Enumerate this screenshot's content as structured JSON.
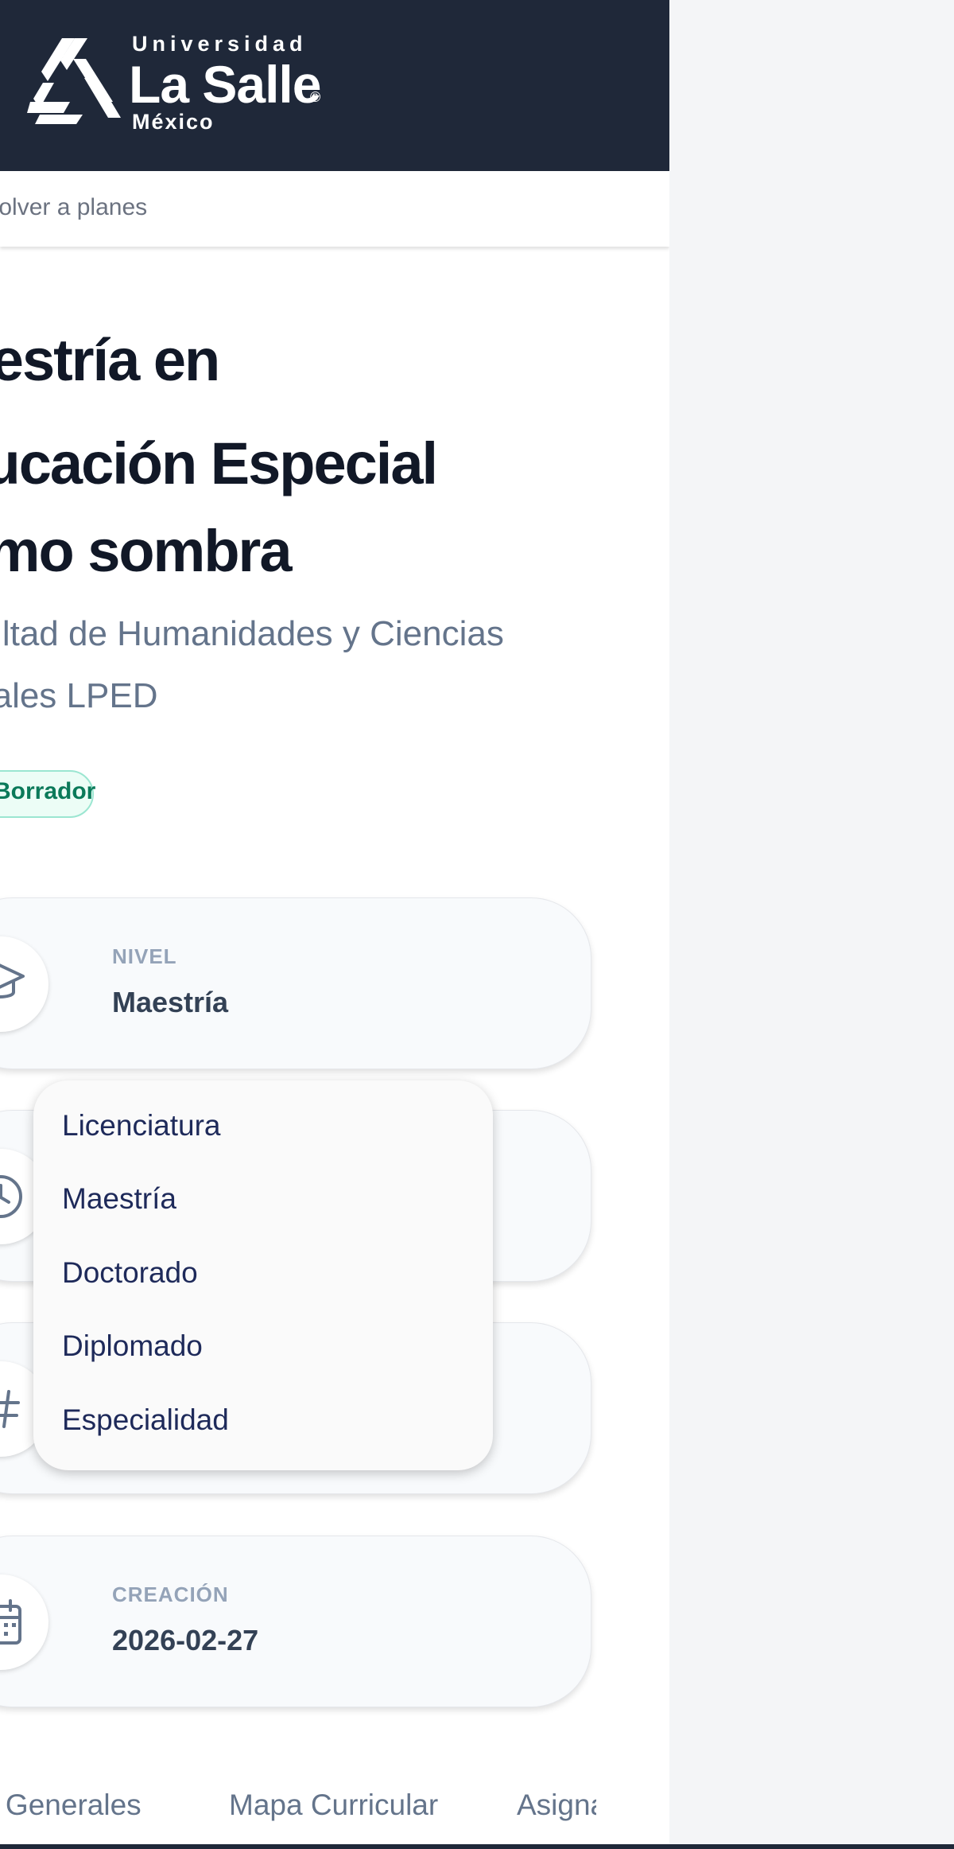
{
  "header": {
    "logo": {
      "superscript": "Universidad",
      "name": "La Salle",
      "registered": "®",
      "subscript": "México",
      "icon": "la-salle-star-logo"
    },
    "back_link": "Volver a planes"
  },
  "program": {
    "title_lines": [
      "Maestría en",
      "Educación Especial",
      "Como sombra"
    ],
    "faculty_lines": [
      "Facultad de Humanidades y Ciencias",
      "Sociales LPED"
    ],
    "status": "Borrador"
  },
  "cards": [
    {
      "icon": "graduation-cap-icon",
      "label": "NIVEL",
      "value": "Maestría"
    },
    {
      "icon": "clock-icon",
      "label": "",
      "value": ""
    },
    {
      "icon": "hash-icon",
      "label": "",
      "value": ""
    },
    {
      "icon": "calendar-icon",
      "label": "CREACIÓN",
      "value": "2026-02-27"
    }
  ],
  "level_dropdown": {
    "options": [
      "Licenciatura",
      "Maestría",
      "Doctorado",
      "Diplomado",
      "Especialidad"
    ],
    "selected": "Maestría"
  },
  "tabs": [
    "Datos Generales",
    "Mapa Curricular",
    "Asignaturas"
  ],
  "colors": {
    "header_bg": "#1f2839",
    "title": "#111827",
    "muted": "#64748b",
    "status_border": "#9be6d1",
    "status_text": "#0b7a5a",
    "dropdown_text": "#1e2a5a"
  }
}
